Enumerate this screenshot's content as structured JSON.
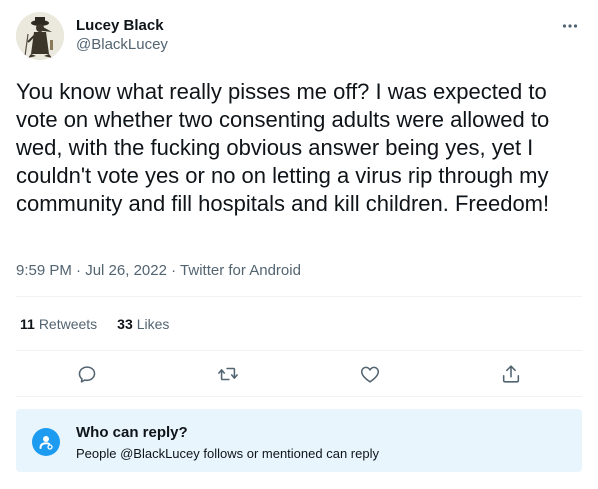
{
  "author": {
    "display_name": "Lucey Black",
    "handle": "@BlackLucey",
    "avatar_icon": "plague-doctor-avatar"
  },
  "tweet": {
    "text": "You know what really pisses me off? I was expected to vote on whether two consenting adults were allowed to wed, with the fucking obvious answer being yes, yet I couldn't vote yes or no on letting a virus rip through my community and fill hospitals and kill children. Freedom!",
    "time": "9:59 PM",
    "separator": "·",
    "date": "Jul 26, 2022",
    "source": "Twitter for Android"
  },
  "stats": {
    "retweets_count": "11",
    "retweets_label": "Retweets",
    "likes_count": "33",
    "likes_label": "Likes"
  },
  "actions": [
    {
      "icon": "reply-icon"
    },
    {
      "icon": "retweet-icon"
    },
    {
      "icon": "like-icon"
    },
    {
      "icon": "share-icon"
    }
  ],
  "reply_restriction": {
    "title": "Who can reply?",
    "description": "People @BlackLucey follows or mentioned can reply",
    "icon": "at-sign-person-icon"
  },
  "colors": {
    "text": "#0f1419",
    "secondary": "#536471",
    "accent": "#1d9bf0",
    "reply_bg": "#e8f5fd"
  }
}
